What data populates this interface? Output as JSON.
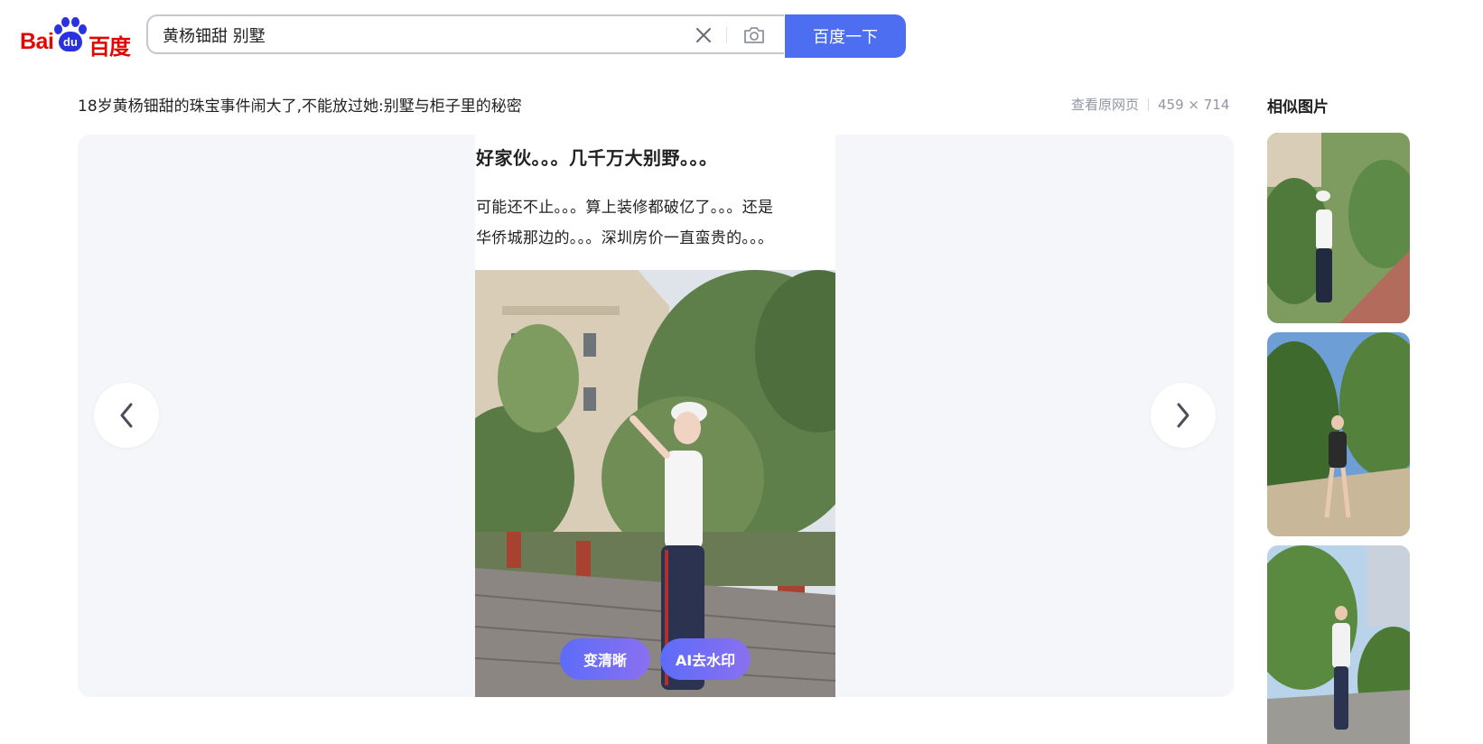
{
  "logo": {
    "bai": "Bai",
    "du": "du",
    "chinese": "百度"
  },
  "search": {
    "query": "黄杨钿甜 别墅",
    "button_label": "百度一下"
  },
  "image": {
    "title": "18岁黄杨钿甜的珠宝事件闹大了,不能放过她:别墅与柜子里的秘密",
    "view_source_label": "查看原网页",
    "dimensions": "459 × 714",
    "caption_line1": "好家伙。。。几千万大别野。。。",
    "caption_line2": "可能还不止。。。算上装修都破亿了。。。还是",
    "caption_line3": "华侨城那边的。。。深圳房价一直蛮贵的。。。"
  },
  "tools": {
    "enhance_label": "变清晰",
    "remove_watermark_label": "AI去水印"
  },
  "similar": {
    "title": "相似图片"
  },
  "colors": {
    "brand_red": "#e10602",
    "brand_blue": "#2932e1",
    "search_button": "#4e6ef2",
    "viewer_background": "#f5f6f9",
    "pill_gradient_start": "#5d6cf8",
    "pill_gradient_end": "#8a70f0"
  },
  "icons": [
    "clear-icon",
    "camera-icon",
    "chevron-left-icon",
    "chevron-right-icon"
  ]
}
